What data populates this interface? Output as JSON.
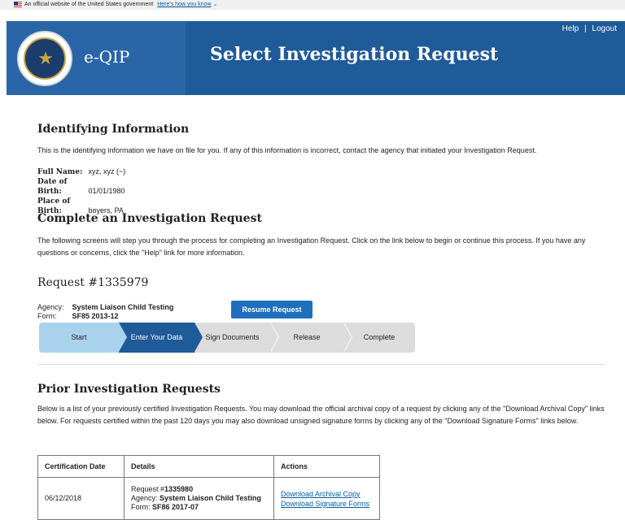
{
  "gov_banner": {
    "text": "An official website of the United States government",
    "link": "Here's how you know"
  },
  "header": {
    "brand": "e-QIP",
    "title": "Select Investigation Request",
    "help": "Help",
    "separator": "|",
    "logout": "Logout"
  },
  "identifying": {
    "title": "Identifying Information",
    "description": "This is the identifying information we have on file for you. If any of this information is incorrect, contact the agency that initiated your Investigation Request.",
    "full_name_label": "Full Name:",
    "full_name": "xyz, xyz (~)",
    "dob_label": "Date of Birth:",
    "dob": "01/01/1980",
    "pob_label": "Place of Birth:",
    "pob": "boyers, PA"
  },
  "complete": {
    "title": "Complete an Investigation Request",
    "description": "The following screens will step you through the process for completing an Investigation Request. Click on the link below to begin or continue this process. If you have any questions or concerns, click the \"Help\" link for more information."
  },
  "request": {
    "number": "Request #1335979",
    "agency_label": "Agency:",
    "agency": "System Liaison Child Testing",
    "form_label": "Form:",
    "form": "SF85 2013-12",
    "resume_button": "Resume Request"
  },
  "steps": [
    "Start",
    "Enter Your Data",
    "Sign Documents",
    "Release",
    "Complete"
  ],
  "prior": {
    "title": "Prior Investigation Requests",
    "description": "Below is a list of your previously certified Investigation Requests. You may download the official archival copy of a request by clicking any of the \"Download Archival Copy\" links below. For requests certified within the past 120 days you may also download unsigned signature forms by clicking any of the \"Download Signature Forms\" links below.",
    "columns": [
      "Certification Date",
      "Details",
      "Actions"
    ],
    "rows": [
      {
        "date": "06/12/2018",
        "request_label": "Request #",
        "request_number": "1335980",
        "agency_label": "Agency: ",
        "agency": "System Liaison Child Testing",
        "form_label": "Form: ",
        "form": "SF86 2017-07",
        "action_archival": "Download Archival Copy",
        "action_signature": "Download Signature Forms"
      }
    ]
  }
}
